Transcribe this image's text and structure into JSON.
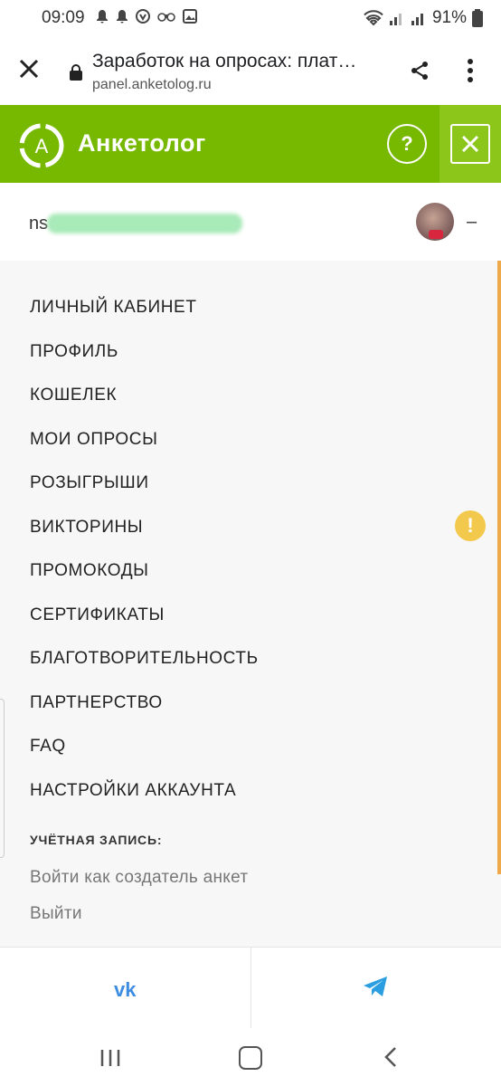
{
  "status_bar": {
    "time": "09:09",
    "battery": "91%"
  },
  "browser": {
    "title": "Заработок на опросах: плат…",
    "url": "panel.anketolog.ru"
  },
  "header": {
    "brand": "Анкетолог",
    "logo_letter": "А",
    "help_label": "?"
  },
  "user": {
    "name_prefix": "ns",
    "dropdown_label": "–"
  },
  "menu": {
    "items": [
      "ЛИЧНЫЙ КАБИНЕТ",
      "ПРОФИЛЬ",
      "КОШЕЛЕК",
      "МОИ ОПРОСЫ",
      "РОЗЫГРЫШИ",
      "ВИКТОРИНЫ",
      "ПРОМОКОДЫ",
      "СЕРТИФИКАТЫ",
      "БЛАГОТВОРИТЕЛЬНОСТЬ",
      "ПАРТНЕРСТВО",
      "FAQ",
      "НАСТРОЙКИ АККАУНТА"
    ],
    "warning_badge": "!",
    "account_heading": "УЧЁТНАЯ ЗАПИСЬ:",
    "account_links": [
      "Войти как создатель анкет",
      "Выйти"
    ]
  },
  "social": {
    "vk_label": "vk"
  },
  "colors": {
    "brand_green": "#77b800",
    "accent_orange": "#f0a94a",
    "warning_yellow": "#f2c94c",
    "vk_blue": "#3d8ee0"
  },
  "icons": [
    "close-icon",
    "lock-icon",
    "share-icon",
    "more-vert-icon",
    "help-icon",
    "vk-icon",
    "telegram-icon"
  ]
}
